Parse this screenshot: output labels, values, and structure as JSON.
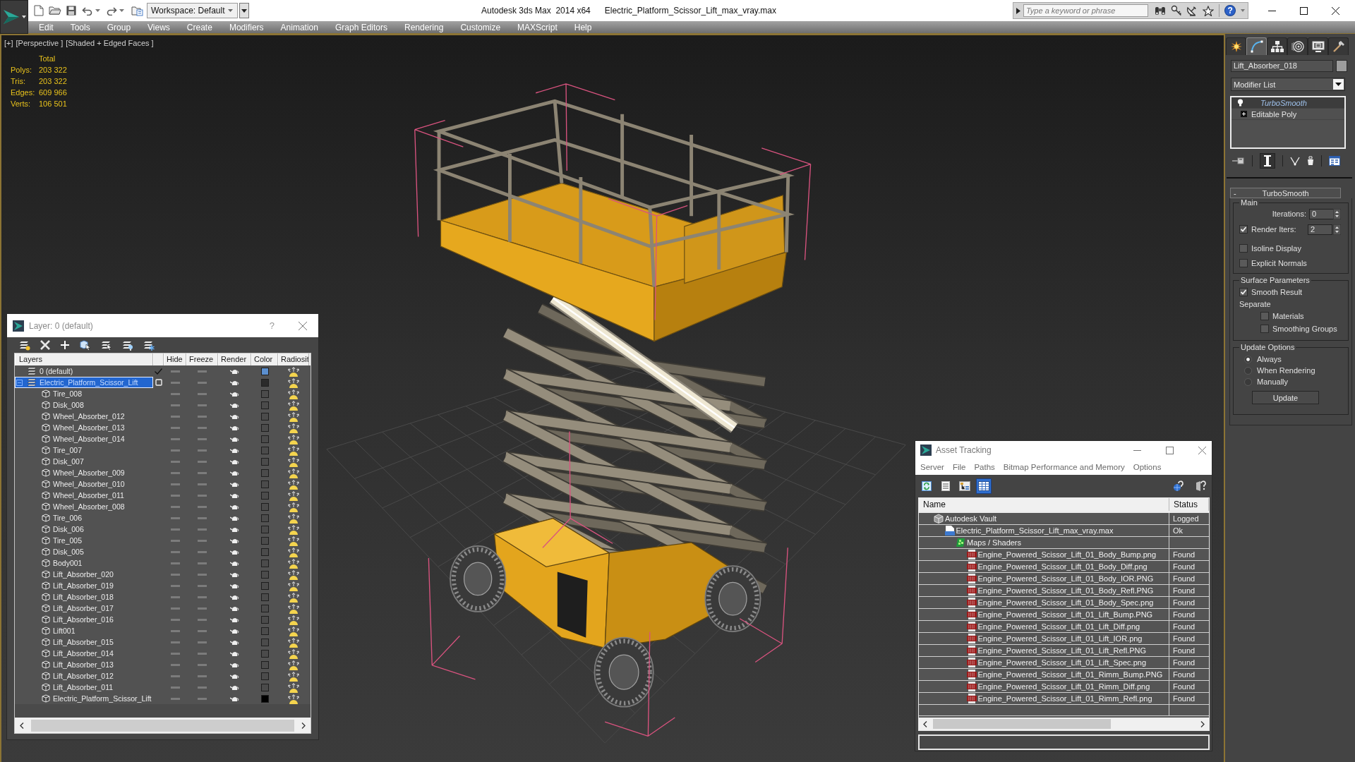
{
  "title_bar": {
    "workspace": "Workspace: Default",
    "app_title": "Autodesk 3ds Max  2014 x64",
    "file_name": "Electric_Platform_Scissor_Lift_max_vray.max",
    "search": {
      "placeholder": "Type a keyword or phrase"
    },
    "help": "?"
  },
  "menu_bar": [
    "Edit",
    "Tools",
    "Group",
    "Views",
    "Create",
    "Modifiers",
    "Animation",
    "Graph Editors",
    "Rendering",
    "Customize",
    "MAXScript",
    "Help"
  ],
  "viewport": {
    "labels": [
      "[+]",
      "[Perspective ]",
      "[Shaded + Edged Faces ]"
    ],
    "stats": {
      "header": "Total",
      "rows": [
        {
          "label": "Polys:",
          "value": "203 322"
        },
        {
          "label": "Tris:",
          "value": "203 322"
        },
        {
          "label": "Edges:",
          "value": "609 966"
        },
        {
          "label": "Verts:",
          "value": "106 501"
        }
      ]
    }
  },
  "layer_window": {
    "title": "Layer: 0 (default)",
    "help": "?",
    "columns": [
      "Layers",
      "Hide",
      "Freeze",
      "Render",
      "Color",
      "Radiosit"
    ],
    "layers": [
      {
        "name": "0 (default)",
        "current": true,
        "selected": false,
        "hidden": false,
        "frozen": false,
        "color": "#5b8fcf"
      },
      {
        "name": "Electric_Platform_Scissor_Lift",
        "current": false,
        "selected": true,
        "expanded": true,
        "hidden": false,
        "frozen": false,
        "color": "#2b2b2b",
        "children": [
          {
            "name": "Tire_008",
            "selected": false,
            "hidden": false,
            "frozen": false,
            "color": "#4b4b4b"
          },
          {
            "name": "Disk_008",
            "selected": false,
            "hidden": false,
            "frozen": false,
            "color": "#4b4b4b"
          },
          {
            "name": "Wheel_Absorber_012",
            "selected": false,
            "hidden": false,
            "frozen": false,
            "color": "#4b4b4b"
          },
          {
            "name": "Wheel_Absorber_013",
            "selected": false,
            "hidden": false,
            "frozen": false,
            "color": "#4b4b4b"
          },
          {
            "name": "Wheel_Absorber_014",
            "selected": false,
            "hidden": false,
            "frozen": false,
            "color": "#4b4b4b"
          },
          {
            "name": "Tire_007",
            "selected": false,
            "hidden": false,
            "frozen": false,
            "color": "#4b4b4b"
          },
          {
            "name": "Disk_007",
            "selected": false,
            "hidden": false,
            "frozen": false,
            "color": "#4b4b4b"
          },
          {
            "name": "Wheel_Absorber_009",
            "selected": false,
            "hidden": false,
            "frozen": false,
            "color": "#4b4b4b"
          },
          {
            "name": "Wheel_Absorber_010",
            "selected": false,
            "hidden": false,
            "frozen": false,
            "color": "#4b4b4b"
          },
          {
            "name": "Wheel_Absorber_011",
            "selected": false,
            "hidden": false,
            "frozen": false,
            "color": "#4b4b4b"
          },
          {
            "name": "Wheel_Absorber_008",
            "selected": false,
            "hidden": false,
            "frozen": false,
            "color": "#4b4b4b"
          },
          {
            "name": "Tire_006",
            "selected": false,
            "hidden": false,
            "frozen": false,
            "color": "#4b4b4b"
          },
          {
            "name": "Disk_006",
            "selected": false,
            "hidden": false,
            "frozen": false,
            "color": "#4b4b4b"
          },
          {
            "name": "Tire_005",
            "selected": false,
            "hidden": false,
            "frozen": false,
            "color": "#4b4b4b"
          },
          {
            "name": "Disk_005",
            "selected": false,
            "hidden": false,
            "frozen": false,
            "color": "#4b4b4b"
          },
          {
            "name": "Body001",
            "selected": false,
            "hidden": false,
            "frozen": false,
            "color": "#4b4b4b"
          },
          {
            "name": "Lift_Absorber_020",
            "selected": false,
            "hidden": false,
            "frozen": false,
            "color": "#4b4b4b"
          },
          {
            "name": "Lift_Absorber_019",
            "selected": false,
            "hidden": false,
            "frozen": false,
            "color": "#4b4b4b"
          },
          {
            "name": "Lift_Absorber_018",
            "selected": false,
            "hidden": false,
            "frozen": false,
            "color": "#4b4b4b"
          },
          {
            "name": "Lift_Absorber_017",
            "selected": false,
            "hidden": false,
            "frozen": false,
            "color": "#4b4b4b"
          },
          {
            "name": "Lift_Absorber_016",
            "selected": false,
            "hidden": false,
            "frozen": false,
            "color": "#4b4b4b"
          },
          {
            "name": "Lift001",
            "selected": false,
            "hidden": false,
            "frozen": false,
            "color": "#4b4b4b"
          },
          {
            "name": "Lift_Absorber_015",
            "selected": false,
            "hidden": false,
            "frozen": false,
            "color": "#4b4b4b"
          },
          {
            "name": "Lift_Absorber_014",
            "selected": false,
            "hidden": false,
            "frozen": false,
            "color": "#4b4b4b"
          },
          {
            "name": "Lift_Absorber_013",
            "selected": false,
            "hidden": false,
            "frozen": false,
            "color": "#4b4b4b"
          },
          {
            "name": "Lift_Absorber_012",
            "selected": false,
            "hidden": false,
            "frozen": false,
            "color": "#4b4b4b"
          },
          {
            "name": "Lift_Absorber_011",
            "selected": false,
            "hidden": false,
            "frozen": false,
            "color": "#4b4b4b"
          },
          {
            "name": "Electric_Platform_Scissor_Lift",
            "selected": false,
            "hidden": false,
            "frozen": false,
            "color": "#000000"
          }
        ]
      }
    ]
  },
  "command_panel": {
    "tabs": [
      {
        "selected": false
      },
      {
        "selected": true
      },
      {
        "selected": false
      },
      {
        "selected": false
      },
      {
        "selected": false
      },
      {
        "selected": false
      }
    ],
    "object_name": "Lift_Absorber_018",
    "modifier_list": "Modifier List",
    "stack": [
      {
        "name": "TurboSmooth",
        "kind": "modifier",
        "selected": true
      },
      {
        "name": "Editable Poly",
        "kind": "base",
        "selected": false
      }
    ],
    "show_end_result": true,
    "rollout": {
      "toggle": "-",
      "title": "TurboSmooth",
      "main": {
        "title": "Main",
        "iterations": {
          "label": "Iterations:",
          "value": "0"
        },
        "render_iters": {
          "label": "Render Iters:",
          "value": "2",
          "checked": true
        },
        "options": [
          {
            "label": "Isoline Display",
            "checked": false
          },
          {
            "label": "Explicit Normals",
            "checked": false
          }
        ]
      },
      "surface": {
        "title": "Surface Parameters",
        "smooth_result": {
          "label": "Smooth Result",
          "checked": true
        },
        "separate": "Separate",
        "options": [
          {
            "label": "Materials",
            "checked": false
          },
          {
            "label": "Smoothing Groups",
            "checked": false
          }
        ]
      },
      "update": {
        "title": "Update Options",
        "modes": [
          {
            "label": "Always",
            "selected": true
          },
          {
            "label": "When Rendering",
            "selected": false
          },
          {
            "label": "Manually",
            "selected": false
          }
        ],
        "button": "Update"
      }
    }
  },
  "asset_tracking": {
    "title": "Asset Tracking",
    "menu": [
      "Server",
      "File",
      "Paths",
      "Bitmap Performance and Memory",
      "Options"
    ],
    "toolbar": [
      {
        "selected": false
      },
      {
        "selected": false
      },
      {
        "selected": false
      },
      {
        "selected": true
      }
    ],
    "columns": [
      "Name",
      "Status"
    ],
    "rows": [
      {
        "name": "Autodesk Vault",
        "kind": "vault",
        "status": "Logged",
        "children": [
          {
            "name": "Electric_Platform_Scissor_Lift_max_vray.max",
            "kind": "max",
            "status": "Ok",
            "children": [
              {
                "name": "Maps / Shaders",
                "kind": "folder",
                "children": [
                  {
                    "name": "Engine_Powered_Scissor_Lift_01_Body_Bump.png",
                    "kind": "png",
                    "status": "Found"
                  },
                  {
                    "name": "Engine_Powered_Scissor_Lift_01_Body_Diff.png",
                    "kind": "png",
                    "status": "Found"
                  },
                  {
                    "name": "Engine_Powered_Scissor_Lift_01_Body_IOR.PNG",
                    "kind": "png",
                    "status": "Found"
                  },
                  {
                    "name": "Engine_Powered_Scissor_Lift_01_Body_Refl.PNG",
                    "kind": "png",
                    "status": "Found"
                  },
                  {
                    "name": "Engine_Powered_Scissor_Lift_01_Body_Spec.png",
                    "kind": "png",
                    "status": "Found"
                  },
                  {
                    "name": "Engine_Powered_Scissor_Lift_01_Lift_Bump.PNG",
                    "kind": "png",
                    "status": "Found"
                  },
                  {
                    "name": "Engine_Powered_Scissor_Lift_01_Lift_Diff.png",
                    "kind": "png",
                    "status": "Found"
                  },
                  {
                    "name": "Engine_Powered_Scissor_Lift_01_Lift_IOR.png",
                    "kind": "png",
                    "status": "Found"
                  },
                  {
                    "name": "Engine_Powered_Scissor_Lift_01_Lift_Refl.PNG",
                    "kind": "png",
                    "status": "Found"
                  },
                  {
                    "name": "Engine_Powered_Scissor_Lift_01_Lift_Spec.png",
                    "kind": "png",
                    "status": "Found"
                  },
                  {
                    "name": "Engine_Powered_Scissor_Lift_01_Rimm_Bump.PNG",
                    "kind": "png",
                    "status": "Found"
                  },
                  {
                    "name": "Engine_Powered_Scissor_Lift_01_Rimm_Diff.png",
                    "kind": "png",
                    "status": "Found"
                  },
                  {
                    "name": "Engine_Powered_Scissor_Lift_01_Rimm_Refl.png",
                    "kind": "png",
                    "status": "Found"
                  }
                ]
              }
            ]
          }
        ]
      }
    ]
  }
}
